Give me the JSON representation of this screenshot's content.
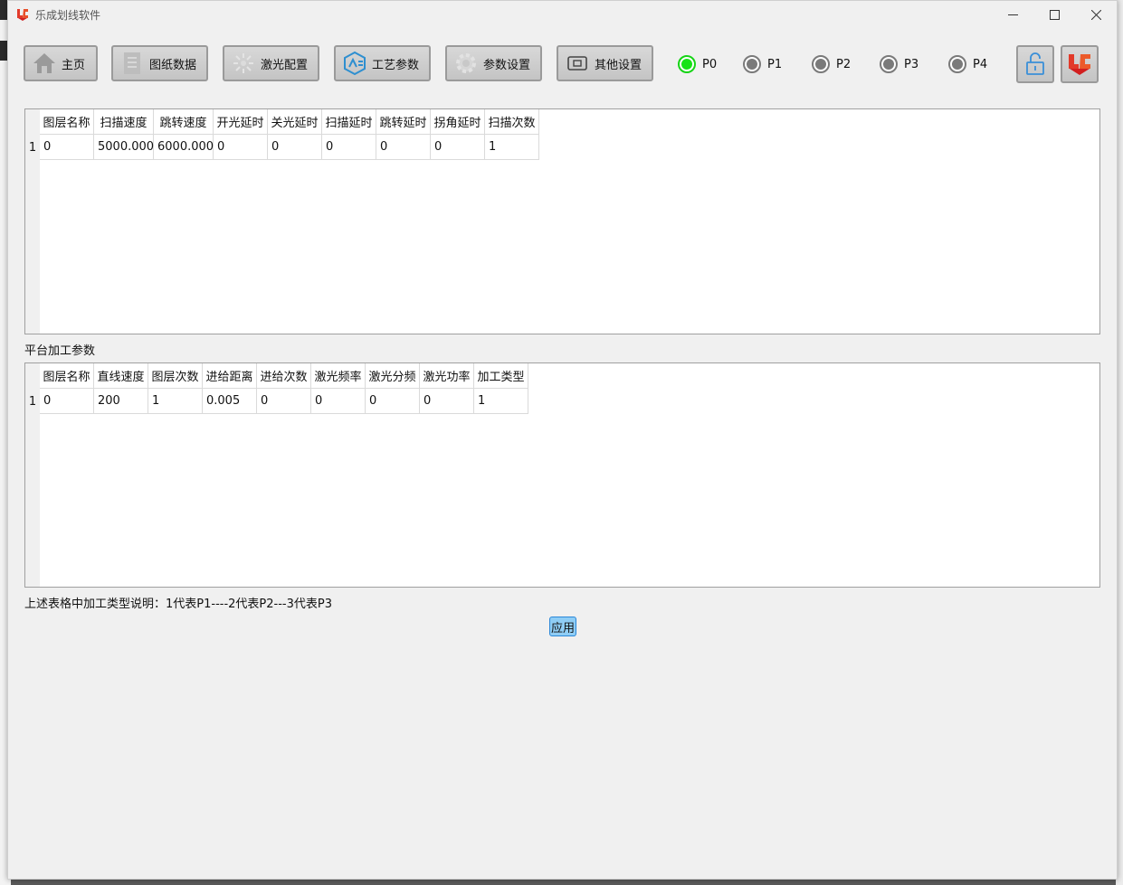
{
  "window": {
    "title": "乐成划线软件"
  },
  "toolbar": {
    "buttons": [
      {
        "label": "主页",
        "icon": "home-icon"
      },
      {
        "label": "图纸数据",
        "icon": "document-icon"
      },
      {
        "label": "激光配置",
        "icon": "laser-icon"
      },
      {
        "label": "工艺参数",
        "icon": "process-icon"
      },
      {
        "label": "参数设置",
        "icon": "gear-icon"
      },
      {
        "label": "其他设置",
        "icon": "device-icon"
      }
    ],
    "indicators": [
      {
        "label": "P0",
        "active": true
      },
      {
        "label": "P1",
        "active": false
      },
      {
        "label": "P2",
        "active": false
      },
      {
        "label": "P3",
        "active": false
      },
      {
        "label": "P4",
        "active": false
      }
    ],
    "lock_icon": "unlock-icon",
    "logo_icon": "lc-logo-icon"
  },
  "laser_table": {
    "headers": [
      "图层名称",
      "扫描速度",
      "跳转速度",
      "开光延时",
      "关光延时",
      "扫描延时",
      "跳转延时",
      "拐角延时",
      "扫描次数"
    ],
    "rows": [
      {
        "index": "1",
        "cells": [
          "0",
          "5000.000",
          "6000.000",
          "0",
          "0",
          "0",
          "0",
          "0",
          "1"
        ]
      }
    ]
  },
  "platform_section_label": "平台加工参数",
  "platform_table": {
    "headers": [
      "图层名称",
      "直线速度",
      "图层次数",
      "进给距离",
      "进给次数",
      "激光频率",
      "激光分频",
      "激光功率",
      "加工类型"
    ],
    "rows": [
      {
        "index": "1",
        "cells": [
          "0",
          "200",
          "1",
          "0.005",
          "0",
          "0",
          "0",
          "0",
          "1"
        ]
      }
    ]
  },
  "note": "上述表格中加工类型说明：1代表P1----2代表P2---3代表P3",
  "apply_label": "应用",
  "colors": {
    "accent": "#8fcdf5",
    "indicator_on": "#16e316",
    "indicator_off": "#7a7a7a"
  }
}
